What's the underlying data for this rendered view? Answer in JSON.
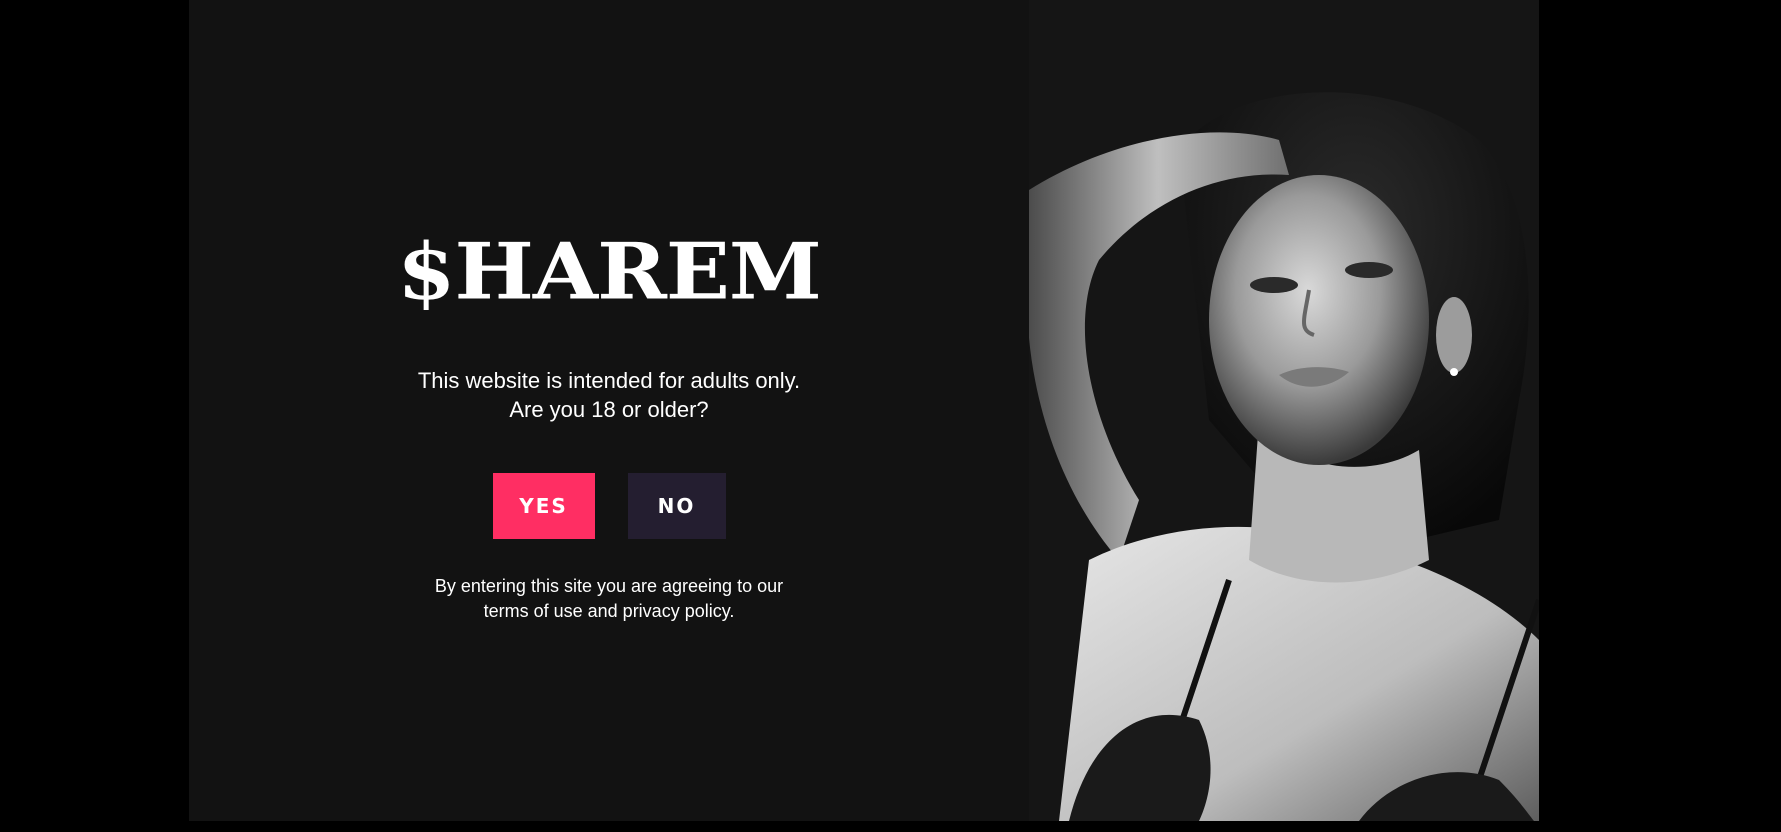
{
  "logo": {
    "text": "$HAREM"
  },
  "age_prompt": {
    "line1": "This website is intended for adults only.",
    "line2": "Are you 18 or older?"
  },
  "buttons": {
    "yes_label": "YES",
    "no_label": "NO"
  },
  "disclaimer": {
    "line1": "By entering this site you are agreeing to our",
    "line2": "terms of use and privacy policy."
  },
  "photo": {
    "description_icon": "portrait-photo"
  },
  "colors": {
    "page_background": "#000000",
    "modal_background": "#121212",
    "yes_button": "#ff2e63",
    "no_button": "#241e30",
    "text": "#ffffff"
  }
}
